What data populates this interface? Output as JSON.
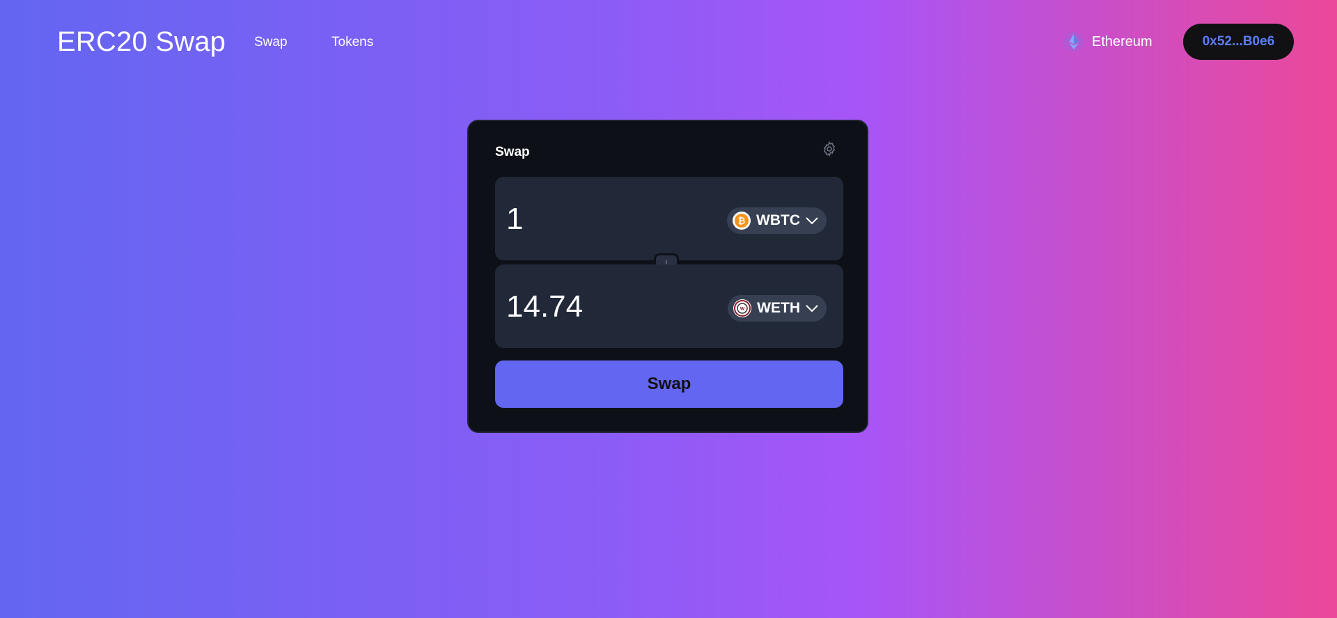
{
  "header": {
    "logo": "ERC20 Swap",
    "nav": [
      {
        "label": "Swap"
      },
      {
        "label": "Tokens"
      }
    ],
    "network": {
      "label": "Ethereum",
      "icon": "ethereum-icon"
    },
    "wallet": {
      "address": "0x52...B0e6"
    }
  },
  "swap_card": {
    "title": "Swap",
    "settings_icon": "gear-icon",
    "from": {
      "amount": "1",
      "token": "WBTC",
      "token_icon": "bitcoin-icon"
    },
    "to": {
      "amount": "14.74",
      "token": "WETH",
      "token_icon": "weth-icon"
    },
    "switch_icon": "arrow-down-icon",
    "submit_label": "Swap"
  },
  "colors": {
    "gradient_start": "#6366f1",
    "gradient_mid": "#8b5cf6",
    "gradient_end": "#ec4899",
    "card_bg": "#0d1117",
    "input_bg": "#212838",
    "accent": "#6366f1",
    "wallet_text": "#5b7dfa"
  }
}
